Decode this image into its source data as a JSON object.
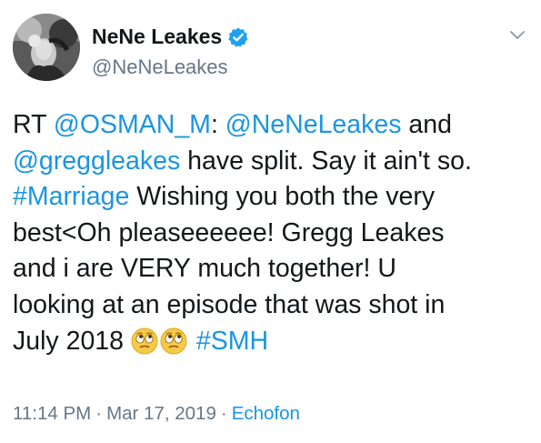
{
  "user": {
    "display_name": "NeNe Leakes",
    "handle": "@NeNeLeakes",
    "verified": true
  },
  "tweet": {
    "lines": [
      [
        {
          "text": "RT ",
          "kind": "text"
        },
        {
          "text": "@OSMAN_M",
          "kind": "link"
        },
        {
          "text": ": ",
          "kind": "text"
        },
        {
          "text": "@NeNeLeakes",
          "kind": "link"
        },
        {
          "text": " and",
          "kind": "text"
        }
      ],
      [
        {
          "text": "@greggleakes",
          "kind": "link"
        },
        {
          "text": " have split. Say it ain't so.",
          "kind": "text"
        }
      ],
      [
        {
          "text": "#Marriage",
          "kind": "link"
        },
        {
          "text": " Wishing you both the very",
          "kind": "text"
        }
      ],
      [
        {
          "text": "best<Oh pleaseeeeee! Gregg Leakes",
          "kind": "text"
        }
      ],
      [
        {
          "text": "and i are VERY much together! U",
          "kind": "text"
        }
      ],
      [
        {
          "text": "looking at an episode that was shot in",
          "kind": "text"
        }
      ],
      [
        {
          "text": "July 2018 ",
          "kind": "text"
        },
        {
          "text": "face-with-rolling-eyes",
          "kind": "emoji"
        },
        {
          "text": "face-with-rolling-eyes",
          "kind": "emoji"
        },
        {
          "text": " ",
          "kind": "text"
        },
        {
          "text": "#SMH",
          "kind": "link"
        }
      ]
    ]
  },
  "meta": {
    "time": "11:14 PM",
    "separator": "·",
    "date": "Mar 17, 2019",
    "source": "Echofon"
  },
  "icons": {
    "verified": "verified-badge-icon",
    "menu": "chevron-down-icon",
    "emoji": "face-with-rolling-eyes"
  },
  "colors": {
    "link": "#1b95e0",
    "text": "#14171a",
    "secondary": "#657786",
    "verified": "#1da1f2"
  }
}
